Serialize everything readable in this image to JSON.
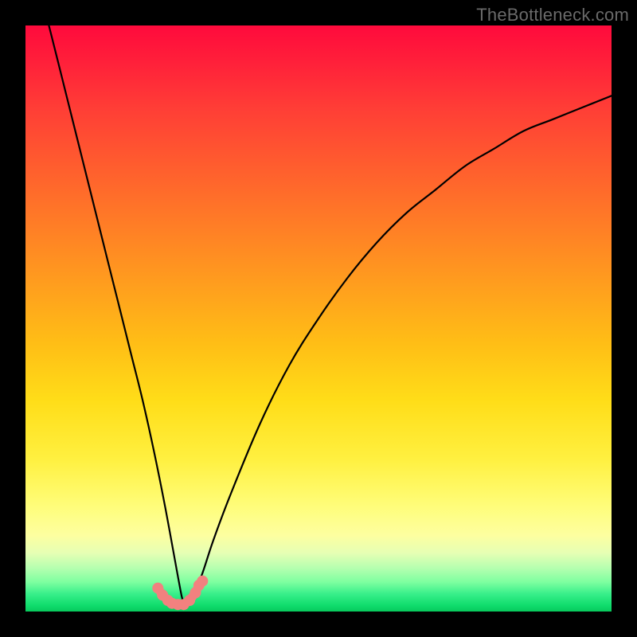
{
  "watermark": {
    "text": "TheBottleneck.com"
  },
  "chart_data": {
    "type": "line",
    "title": "",
    "xlabel": "",
    "ylabel": "",
    "xlim": [
      0,
      100
    ],
    "ylim": [
      0,
      100
    ],
    "series": [
      {
        "name": "bottleneck-curve",
        "x": [
          4,
          6,
          8,
          10,
          12,
          14,
          16,
          18,
          20,
          22,
          24,
          26,
          27,
          28,
          30,
          32,
          35,
          40,
          45,
          50,
          55,
          60,
          65,
          70,
          75,
          80,
          85,
          90,
          95,
          100
        ],
        "y": [
          100,
          92,
          84,
          76,
          68,
          60,
          52,
          44,
          36,
          27,
          17,
          6,
          1.5,
          1.5,
          6,
          12,
          20,
          32,
          42,
          50,
          57,
          63,
          68,
          72,
          76,
          79,
          82,
          84,
          86,
          88
        ]
      }
    ],
    "markers": {
      "name": "highlight-band",
      "color": "#f2817f",
      "x": [
        22.6,
        23.4,
        24.3,
        25.0,
        26.0,
        27.0,
        28.0,
        29.0,
        29.6,
        30.2
      ],
      "y": [
        4.0,
        2.8,
        1.9,
        1.4,
        1.2,
        1.2,
        1.9,
        3.2,
        4.5,
        5.2
      ]
    },
    "colors": {
      "curve": "#000000",
      "marker": "#f2817f",
      "gradient_top": "#ff0a3c",
      "gradient_bottom": "#08c95c",
      "frame": "#000000"
    }
  }
}
